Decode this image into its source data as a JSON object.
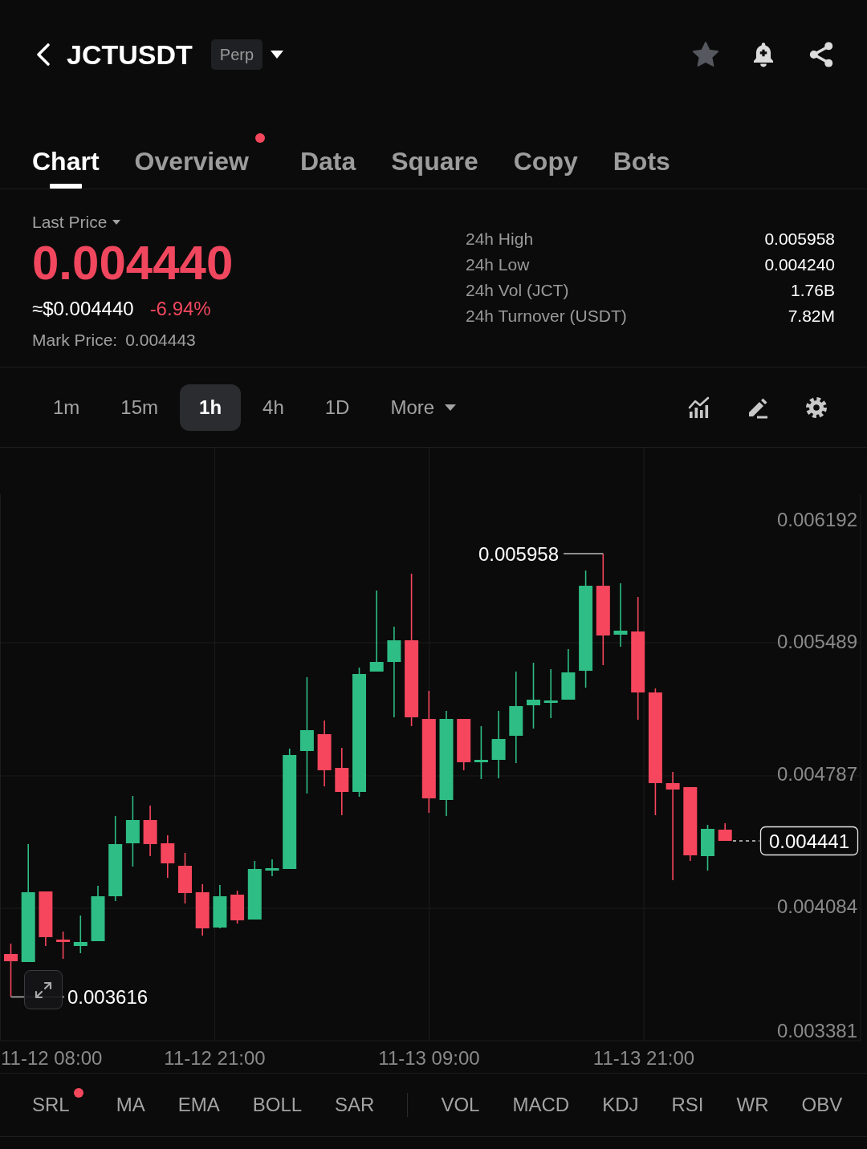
{
  "header": {
    "symbol": "JCTUSDT",
    "contract_badge": "Perp"
  },
  "tabs": [
    {
      "label": "Chart",
      "selected": true,
      "dot": false
    },
    {
      "label": "Overview",
      "selected": false,
      "dot": true
    },
    {
      "label": "Data",
      "selected": false,
      "dot": false
    },
    {
      "label": "Square",
      "selected": false,
      "dot": false
    },
    {
      "label": "Copy",
      "selected": false,
      "dot": false
    },
    {
      "label": "Bots",
      "selected": false,
      "dot": false
    }
  ],
  "price_panel": {
    "last_price_label": "Last Price",
    "last_price": "0.004440",
    "falling": true,
    "usd_value": "≈$0.004440",
    "change": "-6.94%",
    "mark_price_label": "Mark Price:",
    "mark_price": "0.004443",
    "stats": [
      {
        "label": "24h High",
        "value": "0.005958"
      },
      {
        "label": "24h Low",
        "value": "0.004240"
      },
      {
        "label": "24h Vol (JCT)",
        "value": "1.76B"
      },
      {
        "label": "24h Turnover (USDT)",
        "value": "7.82M"
      }
    ]
  },
  "timeframes": [
    {
      "label": "1m",
      "selected": false
    },
    {
      "label": "15m",
      "selected": false
    },
    {
      "label": "1h",
      "selected": true
    },
    {
      "label": "4h",
      "selected": false
    },
    {
      "label": "1D",
      "selected": false
    }
  ],
  "more_menu": {
    "label": "More"
  },
  "chart": {
    "y_axis_labels": [
      "0.006192",
      "0.005489",
      "0.004787",
      "0.004084",
      "0.003381"
    ],
    "x_axis_labels": [
      "11-12 08:00",
      "11-12 21:00",
      "11-13 09:00",
      "11-13 21:00"
    ],
    "high_marker": "0.005958",
    "low_marker": "0.003616",
    "last_price_tag": "0.004441"
  },
  "indicators": {
    "main": [
      {
        "label": "SRL",
        "dot": true
      },
      {
        "label": "MA",
        "dot": false
      },
      {
        "label": "EMA",
        "dot": false
      },
      {
        "label": "BOLL",
        "dot": false
      },
      {
        "label": "SAR",
        "dot": false
      }
    ],
    "sub": [
      {
        "label": "VOL",
        "dot": false
      },
      {
        "label": "MACD",
        "dot": false
      },
      {
        "label": "KDJ",
        "dot": false
      },
      {
        "label": "RSI",
        "dot": false
      },
      {
        "label": "WR",
        "dot": false
      },
      {
        "label": "OBV",
        "dot": false
      }
    ]
  }
}
